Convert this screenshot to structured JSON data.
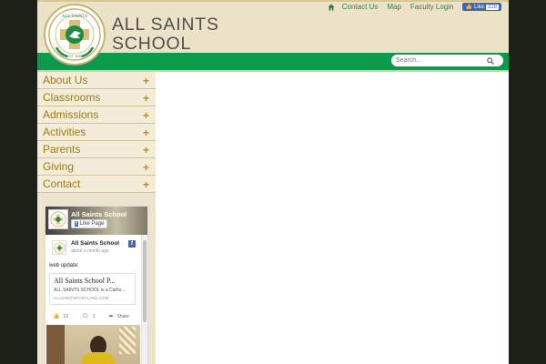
{
  "colors": {
    "background": "#1c2016",
    "header_bg": "#ece2c7",
    "green_bar": "#0c9a4c",
    "menu_text": "#9a7b1c",
    "top_link": "#2f7f49",
    "facebook_blue": "#4267b2"
  },
  "header": {
    "school_name_line1": "ALL SAINTS",
    "school_name_line2": "SCHOOL",
    "logo_text_top": "ALL SAINTS",
    "logo_text_bottom": "EST. 1928"
  },
  "topnav": {
    "home_icon": "home-icon",
    "links": [
      "Contact Us",
      "Map",
      "Faculty Login"
    ],
    "fb_like_label": "Like",
    "fb_like_count": "316"
  },
  "search": {
    "placeholder": "Search...",
    "icon": "search-icon"
  },
  "sidebar": {
    "items": [
      {
        "label": "About Us",
        "toggle": "+"
      },
      {
        "label": "Classrooms",
        "toggle": "+"
      },
      {
        "label": "Admissions",
        "toggle": "+"
      },
      {
        "label": "Activities",
        "toggle": "+"
      },
      {
        "label": "Parents",
        "toggle": "+"
      },
      {
        "label": "Giving",
        "toggle": "+"
      },
      {
        "label": "Contact",
        "toggle": "+"
      }
    ]
  },
  "facebook_widget": {
    "page_name": "All Saints School",
    "like_page_label": "Like Page",
    "post": {
      "author": "All Saints School",
      "time": "about a month ago",
      "text": "web update:",
      "link_title": "All Saints School P...",
      "link_desc": "ALL SAINTS SCHOOL is a Catho...",
      "link_url": "ALLSAINTSPORTLAND.COM",
      "likes": "13",
      "comments": "1",
      "share_label": "Share"
    }
  }
}
